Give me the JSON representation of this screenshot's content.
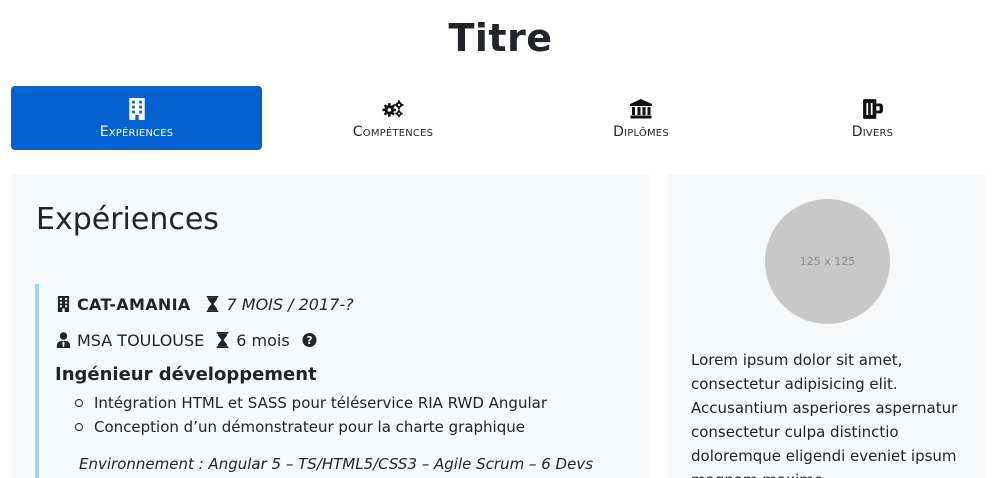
{
  "page_title": "Titre",
  "tabs": [
    {
      "label": "Expériences",
      "icon": "building-icon",
      "active": true
    },
    {
      "label": "Compétences",
      "icon": "gears-icon",
      "active": false
    },
    {
      "label": "Diplômes",
      "icon": "university-icon",
      "active": false
    },
    {
      "label": "Divers",
      "icon": "beer-icon",
      "active": false
    }
  ],
  "accent_color": "#0362d0",
  "main": {
    "section_title": "Expériences",
    "experience": {
      "company": "CAT-AMANIA",
      "total_duration": "7 MOIS / 2017-?",
      "client": "MSA TOULOUSE",
      "duration": "6 mois",
      "job_title": "Ingénieur développement",
      "tasks": [
        "Intégration HTML et SASS pour téléservice RIA RWD Angular",
        "Conception d’un démonstrateur pour la charte graphique"
      ],
      "environment": "Environnement : Angular 5 – TS/HTML5/CSS3 – Agile Scrum – 6 Devs"
    }
  },
  "side": {
    "avatar_placeholder": "125 x 125",
    "text": "Lorem ipsum dolor sit amet, consectetur adipisicing elit. Accusantium asperiores aspernatur consectetur culpa distinctio doloremque eligendi eveniet ipsum magnam maxime"
  }
}
